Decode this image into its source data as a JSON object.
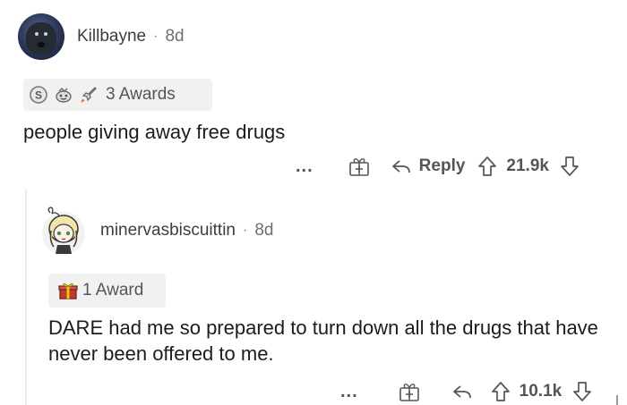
{
  "comment": {
    "username": "Killbayne",
    "separator": "·",
    "age": "8d",
    "awards": {
      "icons": [
        "silver-coin-award-icon",
        "wholesome-award-icon",
        "rocket-award-icon"
      ],
      "label": "3 Awards"
    },
    "body": "people giving away free drugs",
    "actions": {
      "more": "...",
      "gift_icon": "gift-icon",
      "reply_label": "Reply",
      "score": "21.9k"
    }
  },
  "reply": {
    "username": "minervasbiscuittin",
    "separator": "·",
    "age": "8d",
    "awards": {
      "icons": [
        "gift-box-award-icon"
      ],
      "label": "1 Award"
    },
    "body": "DARE had me so prepared to turn down all the drugs that have never been offered to me.",
    "actions": {
      "more": "...",
      "gift_icon": "gift-icon",
      "score": "10.1k"
    }
  }
}
